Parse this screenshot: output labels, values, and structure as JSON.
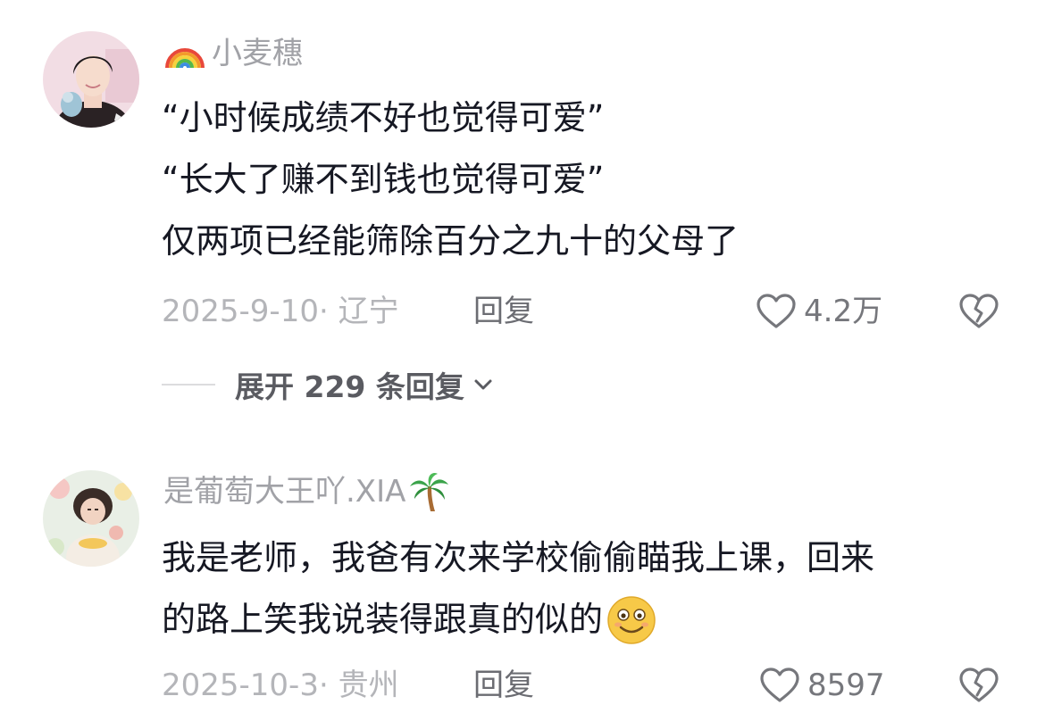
{
  "comments": [
    {
      "username": "小麦穗",
      "name_emoji": "rainbow-emoji",
      "lines": [
        "“小时候成绩不好也觉得可爱”",
        "“长大了赚不到钱也觉得可爱”",
        "仅两项已经能筛除百分之九十的父母了"
      ],
      "meta": "2025-9-10· 辽宁",
      "reply_label": "回复",
      "like_count": "4.2万",
      "expand_label": "展开 229 条回复"
    },
    {
      "username": "是葡萄大王吖.XIA",
      "name_emoji": "palm-tree-emoji",
      "lines": [
        "我是老师，我爸有次来学校偷偷瞄我上课，回来",
        "的路上笑我说装得跟真的似的"
      ],
      "end_emoji": "grinning-face-emoji",
      "meta": "2025-10-3· 贵州",
      "reply_label": "回复",
      "like_count": "8597"
    }
  ],
  "colors": {
    "username": "#a1a2a7",
    "body": "#161823",
    "meta": "#b4b5b9",
    "action": "#76777c"
  }
}
